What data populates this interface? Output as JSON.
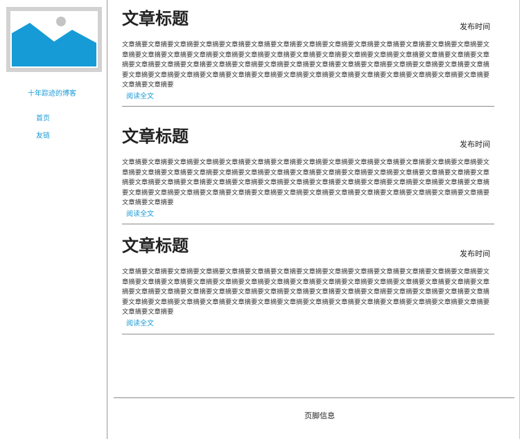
{
  "sidebar": {
    "blog_name": "十年踪迹的博客",
    "nav": [
      {
        "label": "首页"
      },
      {
        "label": "友链"
      }
    ]
  },
  "articles": [
    {
      "title": "文章标题",
      "time": "发布时间",
      "summary": "文章摘要文章摘要文章摘要文章摘要文章摘要文章摘要文章摘要文章摘要文章摘要文章摘要文章摘要文章摘要文章摘要文章摘要文章摘要文章摘要文章摘要文章摘要文章摘要文章摘要文章摘要文章摘要文章摘要文章摘要文章摘要文章摘要文章摘要文章摘要文章摘要文章摘要文章摘要文章摘要文章摘要文章摘要文章摘要文章摘要文章摘要文章摘要文章摘要文章摘要文章摘要文章摘要文章摘要文章摘要文章摘要文章摘要文章摘要文章摘要文章摘要文章摘要文章摘要文章摘要文章摘要文章摘要文章摘要文章摘要文章摘要文章摘要文章摘要",
      "read_more": "阅读全文"
    },
    {
      "title": "文章标题",
      "time": "发布时间",
      "summary": "文章摘要文章摘要文章摘要文章摘要文章摘要文章摘要文章摘要文章摘要文章摘要文章摘要文章摘要文章摘要文章摘要文章摘要文章摘要文章摘要文章摘要文章摘要文章摘要文章摘要文章摘要文章摘要文章摘要文章摘要文章摘要文章摘要文章摘要文章摘要文章摘要文章摘要文章摘要文章摘要文章摘要文章摘要文章摘要文章摘要文章摘要文章摘要文章摘要文章摘要文章摘要文章摘要文章摘要文章摘要文章摘要文章摘要文章摘要文章摘要文章摘要文章摘要文章摘要文章摘要文章摘要文章摘要文章摘要文章摘要文章摘要文章摘要文章摘要",
      "read_more": "阅读全文"
    },
    {
      "title": "文章标题",
      "time": "发布时间",
      "summary": "文章摘要文章摘要文章摘要文章摘要文章摘要文章摘要文章摘要文章摘要文章摘要文章摘要文章摘要文章摘要文章摘要文章摘要文章摘要文章摘要文章摘要文章摘要文章摘要文章摘要文章摘要文章摘要文章摘要文章摘要文章摘要文章摘要文章摘要文章摘要文章摘要文章摘要文章摘要文章摘要文章摘要文章摘要文章摘要文章摘要文章摘要文章摘要文章摘要文章摘要文章摘要文章摘要文章摘要文章摘要文章摘要文章摘要文章摘要文章摘要文章摘要文章摘要文章摘要文章摘要文章摘要文章摘要文章摘要文章摘要文章摘要文章摘要文章摘要",
      "read_more": "阅读全文"
    }
  ],
  "footer": {
    "text": "页脚信息"
  },
  "colors": {
    "accent": "#1a9bd7",
    "placeholder_bg": "#d2d2d2",
    "divider": "#8a8a8a"
  }
}
